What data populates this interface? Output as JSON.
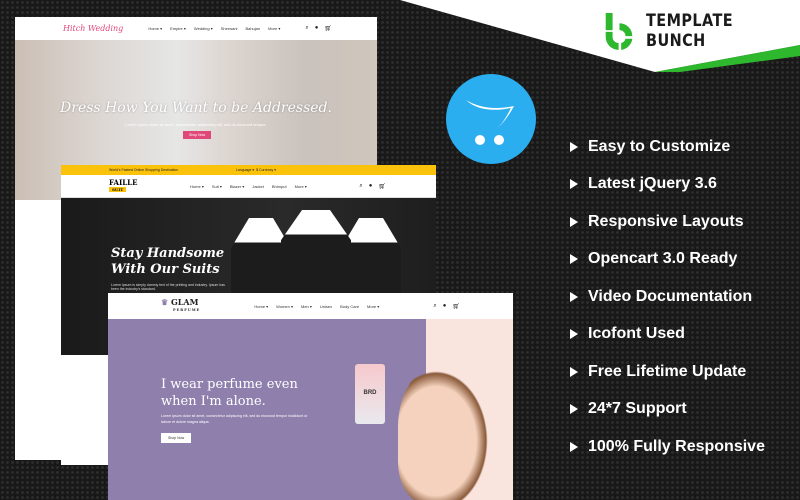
{
  "brand": {
    "name": "TEMPLATE BUNCH",
    "green": "#2db82d"
  },
  "platform_icon": "opencart-cart-icon",
  "features": [
    "Easy to Customize",
    "Latest jQuery 3.6",
    "Responsive Layouts",
    "Opencart 3.0 Ready",
    "Video Documentation",
    "Icofont Used",
    "Free Lifetime Update",
    "24*7 Support",
    "100% Fully Responsive"
  ],
  "wedding": {
    "logo": "Hitch Wedding",
    "nav": [
      "Home ▾",
      "Empire ▾",
      "Wedding ▾",
      "Sherwani",
      "Bahujan",
      "More ▾"
    ],
    "title": "Dress How You Want to be Addressed.",
    "subtitle": "Lorem ipsum dolor sit amet, consectetur adipiscing elit, sed do eiusmod tempor.",
    "button": "Shop Now",
    "accent": "#e1487a"
  },
  "faille": {
    "topbar": "World's Fastest Online Shopping Destination",
    "language": "Language ▾",
    "currency": "$ Currency ▾",
    "logo": "FAILLE",
    "logo_sub": "SUIT",
    "nav": [
      "Home ▾",
      "Suit ▾",
      "Blazer ▾",
      "Jacket",
      "Bhimput",
      "More ▾"
    ],
    "title_line1": "Stay Handsome",
    "title_line2": "With Our Suits",
    "subtitle": "Lorem Ipsum is simply dummy text of the printing and industry. Ipsum has been the industry's standard.",
    "accent": "#fbc20c"
  },
  "glam": {
    "logo": "GLAM",
    "logo_sub": "PERFUME",
    "nav": [
      "Home ▾",
      "Women ▾",
      "Men ▾",
      "Unisex",
      "Body Care",
      "More ▾"
    ],
    "title_line1": "I wear perfume even",
    "title_line2": "when I'm alone.",
    "subtitle": "Lorem ipsum dolor sit amet, consectetur adipiscing elit, sed do eiusmod tempor incididunt ut labore et dolore magna aliqua.",
    "button": "Shop Now",
    "bottle_label": "BRD",
    "accent": "#8e7fad"
  }
}
